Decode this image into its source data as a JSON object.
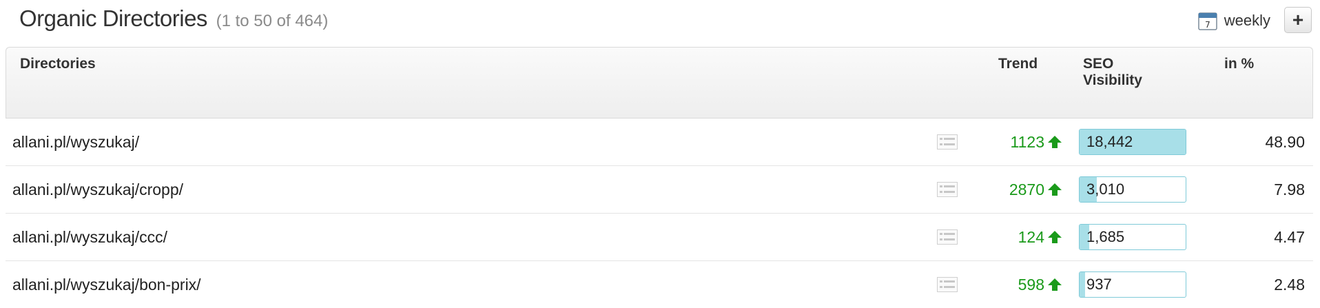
{
  "header": {
    "title": "Organic Directories",
    "count": "(1 to 50 of 464)",
    "period_label": "weekly",
    "add_label": "+"
  },
  "columns": {
    "directories": "Directories",
    "trend": "Trend",
    "seo_visibility": "SEO Visibility",
    "in_percent": "in %"
  },
  "rows": [
    {
      "directory": "allani.pl/wyszukaj/",
      "trend": "1123",
      "visibility": "18,442",
      "visibility_fraction": 1.0,
      "percent": "48.90"
    },
    {
      "directory": "allani.pl/wyszukaj/cropp/",
      "trend": "2870",
      "visibility": "3,010",
      "visibility_fraction": 0.163,
      "percent": "7.98"
    },
    {
      "directory": "allani.pl/wyszukaj/ccc/",
      "trend": "124",
      "visibility": "1,685",
      "visibility_fraction": 0.091,
      "percent": "4.47"
    },
    {
      "directory": "allani.pl/wyszukaj/bon-prix/",
      "trend": "598",
      "visibility": "937",
      "visibility_fraction": 0.051,
      "percent": "2.48"
    }
  ],
  "colors": {
    "trend_up": "#1a9a1a",
    "visibility_fill": "#a8dfe8",
    "visibility_border": "#7fcad8"
  },
  "icons": {
    "period": "calendar-icon",
    "row_detail": "detail-list-icon",
    "trend": "arrow-up-icon"
  }
}
